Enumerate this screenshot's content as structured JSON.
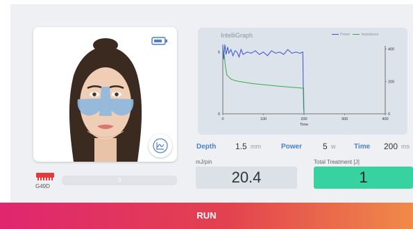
{
  "face_card": {
    "top_icon": "battery-icon",
    "bottom_icon": "graph-icon",
    "treatment_zone_color": "#8fb9de"
  },
  "handpiece": {
    "icon": "handpiece-icon",
    "label": "G49D",
    "color": "#e63a3a"
  },
  "progress": {
    "value_text": "0",
    "fraction": 0.0
  },
  "graph": {
    "title": "IntelliGraph",
    "legend": [
      {
        "name": "Power",
        "color": "#3a4fe0"
      },
      {
        "name": "Impedance",
        "color": "#3aa84a"
      }
    ],
    "xlabel": "Time",
    "x_ticks": [
      "0",
      "100",
      "200",
      "300",
      "400"
    ],
    "y_left_ticks": [
      "0",
      "5"
    ],
    "y_right_ticks": [
      "0",
      "200",
      "400"
    ]
  },
  "chart_data": {
    "type": "line",
    "title": "IntelliGraph",
    "xlabel": "Time",
    "xlim": [
      0,
      400
    ],
    "ylim_left": [
      0,
      5.5
    ],
    "ylim_right": [
      0,
      420
    ],
    "series": [
      {
        "name": "Power",
        "color": "#3a4fe0",
        "x": [
          0,
          2,
          5,
          8,
          12,
          15,
          20,
          25,
          30,
          35,
          40,
          45,
          50,
          60,
          70,
          80,
          90,
          100,
          110,
          120,
          130,
          140,
          150,
          160,
          170,
          180,
          190,
          197,
          198,
          199,
          200
        ],
        "y": [
          5.6,
          4.4,
          5.6,
          4.8,
          5.4,
          4.9,
          5.2,
          4.7,
          5.1,
          5.0,
          4.6,
          5.2,
          4.8,
          5.0,
          4.9,
          5.1,
          4.8,
          5.0,
          4.7,
          5.1,
          4.9,
          5.0,
          4.8,
          5.2,
          4.9,
          5.0,
          4.9,
          5.0,
          2.5,
          0.5,
          0.0
        ]
      },
      {
        "name": "Impedance",
        "color": "#3aa84a",
        "x": [
          0,
          3,
          6,
          10,
          20,
          30,
          40,
          50,
          60,
          80,
          100,
          120,
          140,
          160,
          180,
          199,
          200
        ],
        "y": [
          395,
          380,
          300,
          240,
          215,
          205,
          200,
          196,
          192,
          185,
          180,
          175,
          170,
          166,
          162,
          158,
          0
        ]
      }
    ]
  },
  "params": {
    "depth": {
      "label": "Depth",
      "value": "1.5",
      "unit": "mm"
    },
    "power": {
      "label": "Power",
      "value": "5",
      "unit": "w"
    },
    "time": {
      "label": "Time",
      "value": "200",
      "unit": "ms"
    }
  },
  "energy": {
    "label": "mJ/pin",
    "value": "20.4"
  },
  "total": {
    "label": "Total Treatment [J]",
    "value": "1"
  },
  "run_button": {
    "label": "RUN"
  }
}
